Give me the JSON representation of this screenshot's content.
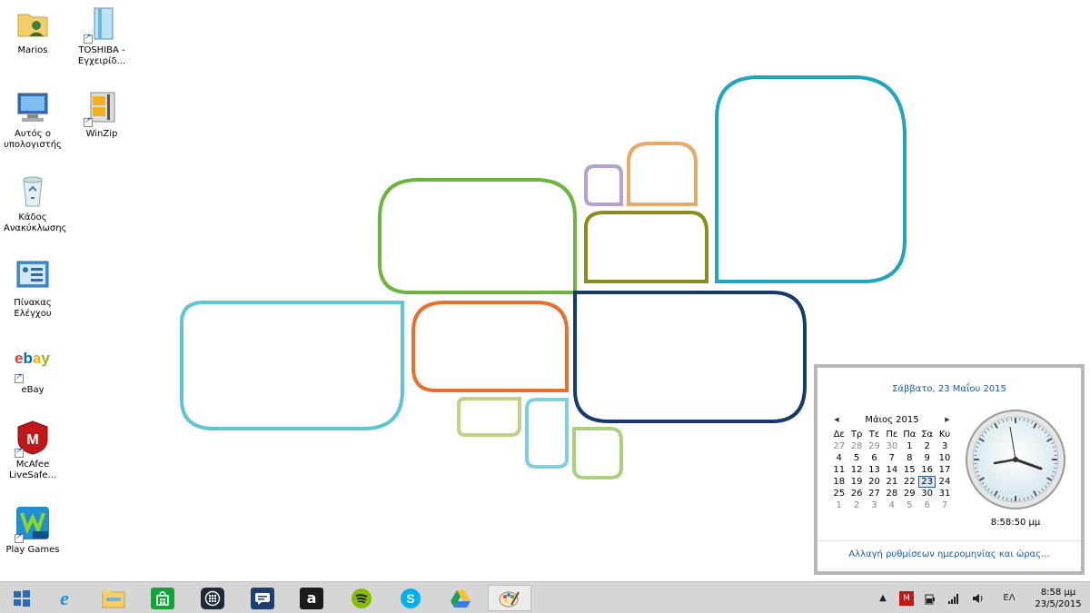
{
  "desktop": {
    "icons": [
      {
        "label": "Marios"
      },
      {
        "label": "TOSHIBA - Εγχειρίδ..."
      },
      {
        "label": "Αυτός ο υπολογιστής"
      },
      {
        "label": "WinZip"
      },
      {
        "label": "Κάδος Ανακύκλωσης"
      },
      {
        "label": "Πίνακας Ελέγχου"
      },
      {
        "label": "eBay"
      },
      {
        "label": "McAfee LiveSafe..."
      },
      {
        "label": "Play Games"
      }
    ],
    "ebay_logo": "ebay",
    "games_badge": "Games"
  },
  "calendar": {
    "full_date": "Σάββατο, 23 Μαΐου 2015",
    "month_label": "Μάιος 2015",
    "weekdays": [
      "Δε",
      "Τρ",
      "Τε",
      "Πε",
      "Πα",
      "Σα",
      "Κυ"
    ],
    "weeks": [
      [
        "27",
        "28",
        "29",
        "30",
        "1",
        "2",
        "3"
      ],
      [
        "4",
        "5",
        "6",
        "7",
        "8",
        "9",
        "10"
      ],
      [
        "11",
        "12",
        "13",
        "14",
        "15",
        "16",
        "17"
      ],
      [
        "18",
        "19",
        "20",
        "21",
        "22",
        "23",
        "24"
      ],
      [
        "25",
        "26",
        "27",
        "28",
        "29",
        "30",
        "31"
      ],
      [
        "1",
        "2",
        "3",
        "4",
        "5",
        "6",
        "7"
      ]
    ],
    "selected_day": "23",
    "digital_time": "8:58:50 μμ",
    "settings_link": "Αλλαγή ρυθμίσεων ημερομηνίας και ώρας..."
  },
  "taskbar": {
    "apps": [
      "start-icon",
      "internet-explorer-icon",
      "file-explorer-icon",
      "store-icon",
      "blackberry-icon",
      "chat-icon",
      "amazon-icon",
      "spotify-icon",
      "skype-icon",
      "google-drive-icon",
      "paint-icon"
    ],
    "language": "ΕΛ",
    "time": "8:58 μμ",
    "date": "23/5/2015"
  },
  "colors": {
    "accent_link": "#1e5aa8",
    "taskbar": "#d6d6d6"
  }
}
